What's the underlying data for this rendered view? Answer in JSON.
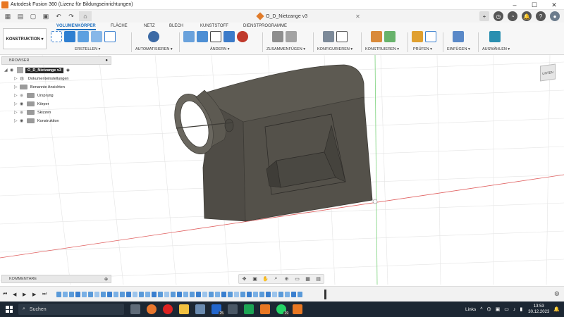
{
  "window": {
    "title": "Autodesk Fusion 360 (Lizenz für Bildungseinrichtungen)",
    "controls": [
      "–",
      "☐",
      "✕"
    ]
  },
  "document_tab": {
    "name": "O_D_Nietzange v3"
  },
  "ribbon": {
    "workspace": "KONSTRUKTION ▾",
    "tabs": [
      "VOLUMENKÖRPER",
      "FLÄCHE",
      "NETZ",
      "BLECH",
      "KUNSTSTOFF",
      "DIENSTPROGRAMME"
    ],
    "active_tab": "VOLUMENKÖRPER",
    "groups": [
      "ERSTELLEN ▾",
      "AUTOMATISIEREN ▾",
      "ÄNDERN ▾",
      "ZUSAMMENFÜGEN ▾",
      "KONFIGURIEREN ▾",
      "KONSTRUIEREN ▾",
      "PRÜFEN ▾",
      "EINFÜGEN ▾",
      "AUSWÄHLEN ▾"
    ]
  },
  "browser": {
    "title": "BROWSER",
    "root": "O_D_Nietzange v3",
    "items": [
      "Dokumenteinstellungen",
      "Benannte Ansichten",
      "Ursprung",
      "Körper",
      "Skizzen",
      "Konstruktion"
    ]
  },
  "viewcube": {
    "label": "UNTEN"
  },
  "comments": {
    "title": "KOMMENTARE"
  },
  "taskbar": {
    "search": "Suchen",
    "badges": [
      "25",
      "19"
    ],
    "tray_label": "Links",
    "time": "13:53",
    "date": "30.12.2023"
  },
  "colors": {
    "accent": "#1e6fbf",
    "model_body": "#5d5a52",
    "model_dark": "#4a4842",
    "axis_red": "#e06060",
    "axis_green": "#60c060",
    "taskbar": "#1c2733"
  }
}
